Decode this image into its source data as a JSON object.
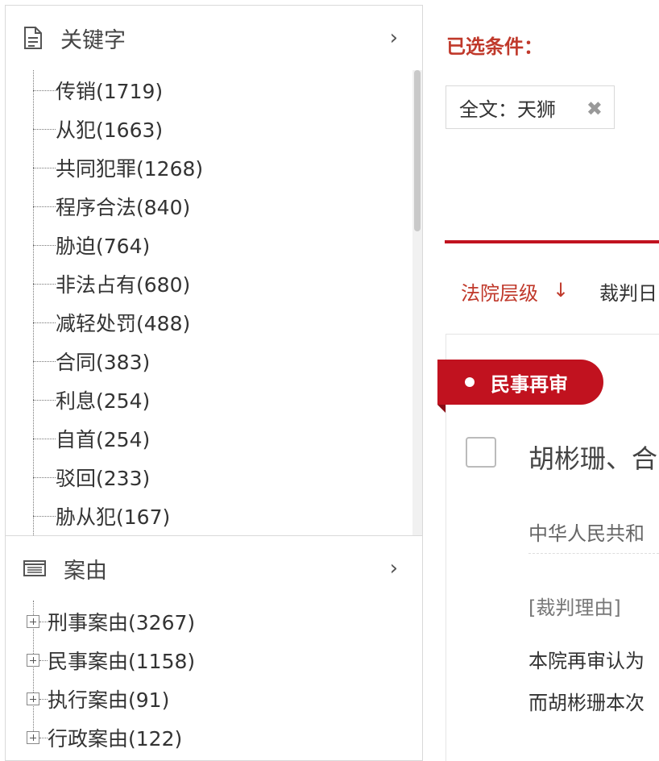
{
  "keyword_panel": {
    "title": "关键字",
    "items": [
      {
        "label": "传销(1719)"
      },
      {
        "label": "从犯(1663)"
      },
      {
        "label": "共同犯罪(1268)"
      },
      {
        "label": "程序合法(840)"
      },
      {
        "label": "胁迫(764)"
      },
      {
        "label": "非法占有(680)"
      },
      {
        "label": "减轻处罚(488)"
      },
      {
        "label": "合同(383)"
      },
      {
        "label": "利息(254)"
      },
      {
        "label": "自首(254)"
      },
      {
        "label": "驳回(233)"
      },
      {
        "label": "胁从犯(167)"
      }
    ]
  },
  "cause_panel": {
    "title": "案由",
    "items": [
      {
        "label": "刑事案由(3267)"
      },
      {
        "label": "民事案由(1158)"
      },
      {
        "label": "执行案由(91)"
      },
      {
        "label": "行政案由(122)"
      }
    ]
  },
  "selected": {
    "label": "已选条件：",
    "chip": "全文：天狮",
    "chip_close": "✖"
  },
  "sort": {
    "court_level": "法院层级",
    "court_level_arrow": "↓",
    "judge_date": "裁判日"
  },
  "result": {
    "ribbon": "民事再审",
    "title": "胡彬珊、合",
    "court": "中华人民共和",
    "reason_label": "[裁判理由]",
    "body_line1": "本院再审认为",
    "body_line2": "而胡彬珊本次"
  },
  "colors": {
    "accent_red": "#c1121f",
    "label_red": "#c0392b"
  }
}
